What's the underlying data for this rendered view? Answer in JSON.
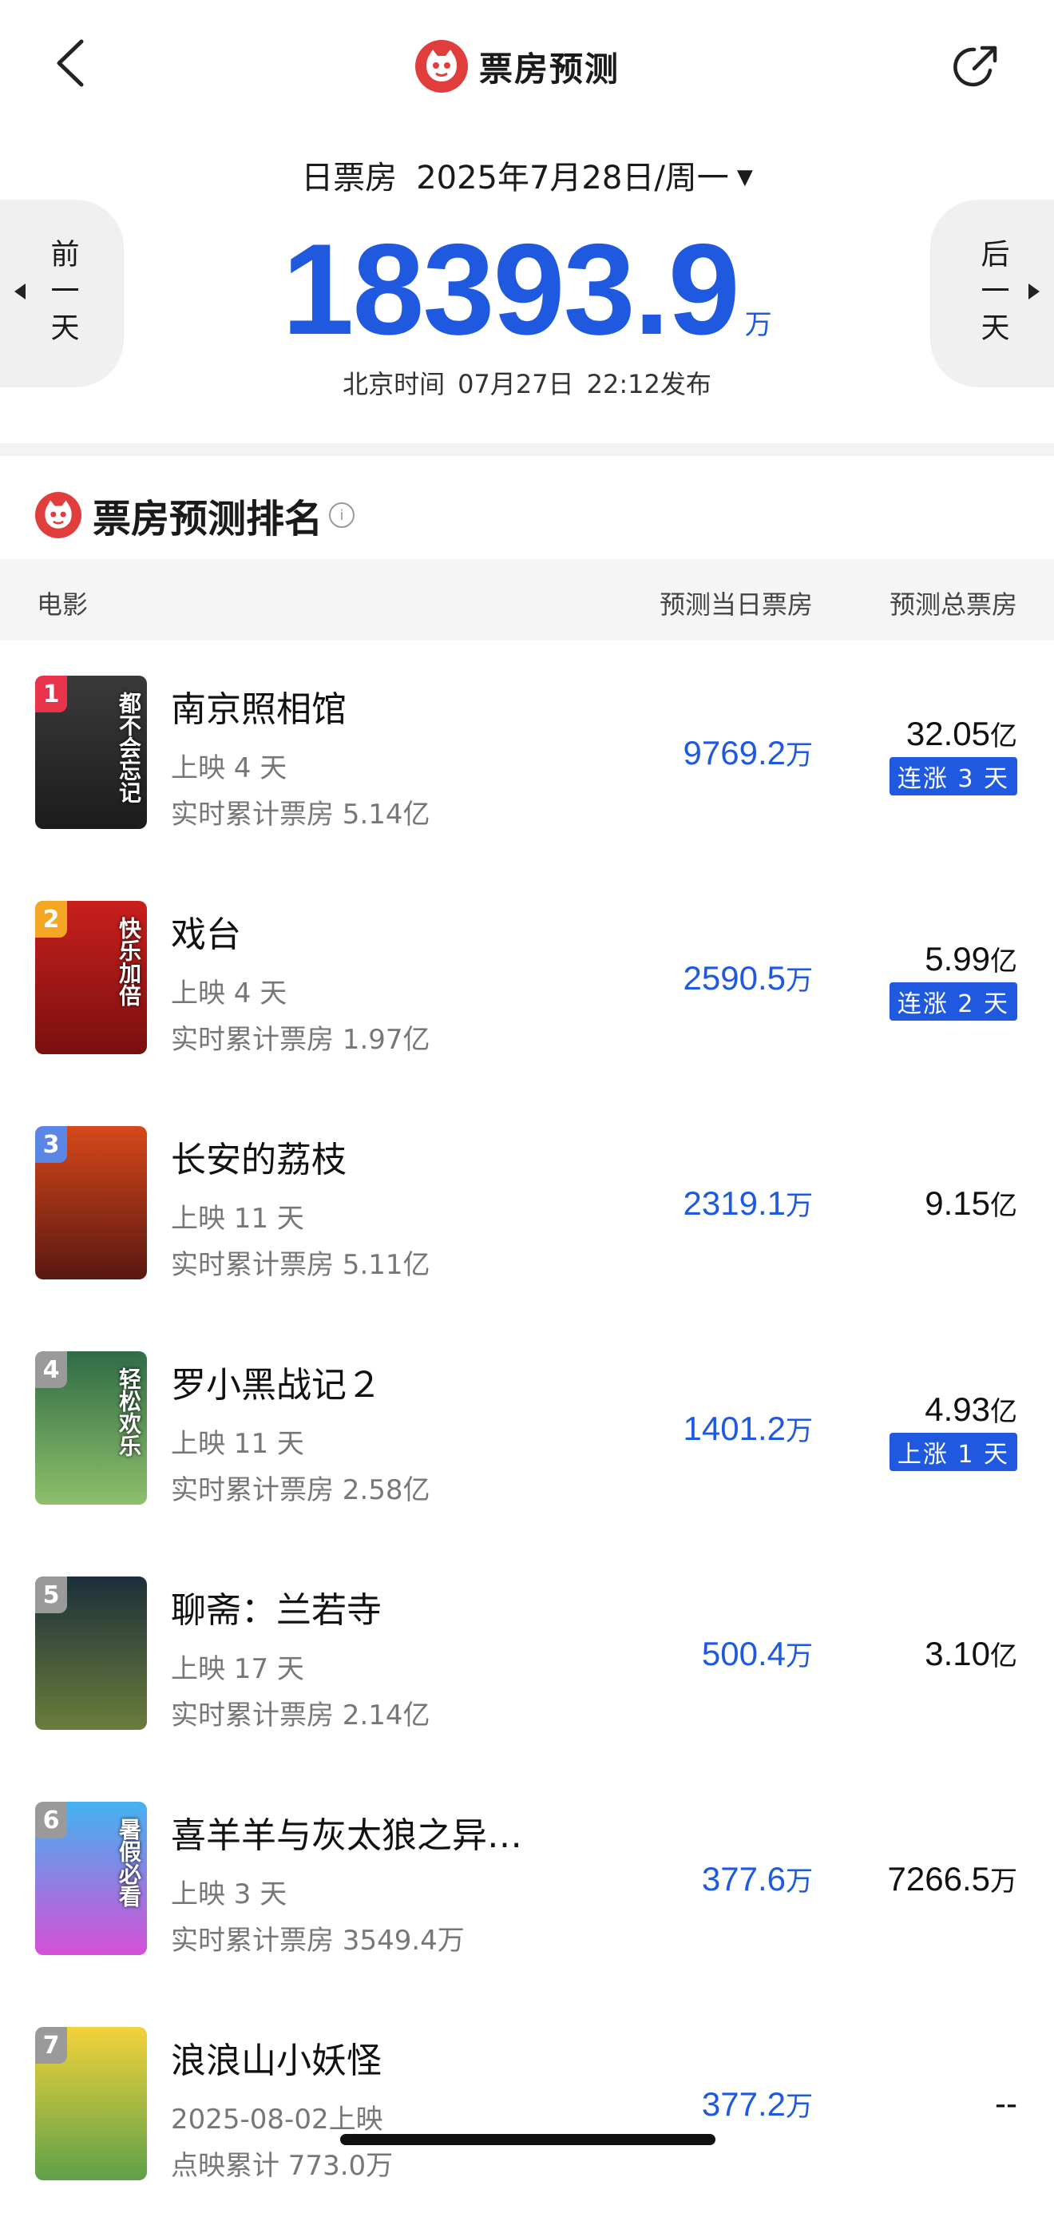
{
  "header": {
    "title": "票房预测",
    "back_icon": "chevron-left-icon",
    "share_icon": "share-icon",
    "logo_icon": "cat-logo-icon"
  },
  "date_selector": {
    "label": "日票房",
    "date": "2025年7月28日/周一",
    "dropdown_icon": "triangle-down-icon"
  },
  "nav": {
    "prev_label": "前一天",
    "next_label": "后一天"
  },
  "total": {
    "value": "18393.9",
    "unit": "万"
  },
  "publish": {
    "prefix": "北京时间",
    "date": "07月27日",
    "time": "22:12发布"
  },
  "ranking": {
    "title": "票房预测排名",
    "columns": [
      "电影",
      "预测当日票房",
      "预测总票房"
    ]
  },
  "colors": {
    "accent": "#1e59e0",
    "brand_red": "#e23d3d"
  },
  "movies": [
    {
      "rank": "1",
      "name": "南京照相馆",
      "days": "上映 4 天",
      "cumulative": "实时累计票房 5.14亿",
      "pred_day": "9769.2",
      "pred_day_unit": "万",
      "pred_total": "32.05",
      "pred_total_unit": "亿",
      "tag": "连涨 3 天",
      "poster_text": "都不会忘记",
      "badge_color": "#e8344a",
      "poster_bg": "linear-gradient(180deg,#3a3a3a,#1c1c1c)"
    },
    {
      "rank": "2",
      "name": "戏台",
      "days": "上映 4 天",
      "cumulative": "实时累计票房 1.97亿",
      "pred_day": "2590.5",
      "pred_day_unit": "万",
      "pred_total": "5.99",
      "pred_total_unit": "亿",
      "tag": "连涨 2 天",
      "poster_text": "快乐加倍",
      "badge_color": "#f5a623",
      "poster_bg": "linear-gradient(180deg,#c8201d,#7a0f0f)"
    },
    {
      "rank": "3",
      "name": "长安的荔枝",
      "days": "上映 11 天",
      "cumulative": "实时累计票房 5.11亿",
      "pred_day": "2319.1",
      "pred_day_unit": "万",
      "pred_total": "9.15",
      "pred_total_unit": "亿",
      "tag": "",
      "poster_text": "",
      "badge_color": "#5b86e5",
      "poster_bg": "linear-gradient(180deg,#d6481a,#5a1712)"
    },
    {
      "rank": "4",
      "name": "罗小黑战记２",
      "days": "上映 11 天",
      "cumulative": "实时累计票房 2.58亿",
      "pred_day": "1401.2",
      "pred_day_unit": "万",
      "pred_total": "4.93",
      "pred_total_unit": "亿",
      "tag": "上涨 1 天",
      "poster_text": "轻松欢乐",
      "badge_color": "#9a9a9a",
      "poster_bg": "linear-gradient(180deg,#2f6c46,#8fbf6a)"
    },
    {
      "rank": "5",
      "name": "聊斋：兰若寺",
      "days": "上映 17 天",
      "cumulative": "实时累计票房 2.14亿",
      "pred_day": "500.4",
      "pred_day_unit": "万",
      "pred_total": "3.10",
      "pred_total_unit": "亿",
      "tag": "",
      "poster_text": "",
      "badge_color": "#9a9a9a",
      "poster_bg": "linear-gradient(180deg,#1c2f3a,#6b7d3b)"
    },
    {
      "rank": "6",
      "name": "喜羊羊与灰太狼之异…",
      "days": "上映 3 天",
      "cumulative": "实时累计票房 3549.4万",
      "pred_day": "377.6",
      "pred_day_unit": "万",
      "pred_total": "7266.5",
      "pred_total_unit": "万",
      "tag": "",
      "poster_text": "暑假必看",
      "badge_color": "#9a9a9a",
      "poster_bg": "linear-gradient(180deg,#43b3f0,#d64fd6)"
    },
    {
      "rank": "7",
      "name": "浪浪山小妖怪",
      "days": "2025-08-02上映",
      "cumulative": "点映累计 773.0万",
      "pred_day": "377.2",
      "pred_day_unit": "万",
      "pred_total": "--",
      "pred_total_unit": "",
      "tag": "",
      "poster_text": "",
      "badge_color": "#9a9a9a",
      "poster_bg": "linear-gradient(180deg,#f2d23a,#5ea04a)"
    }
  ]
}
